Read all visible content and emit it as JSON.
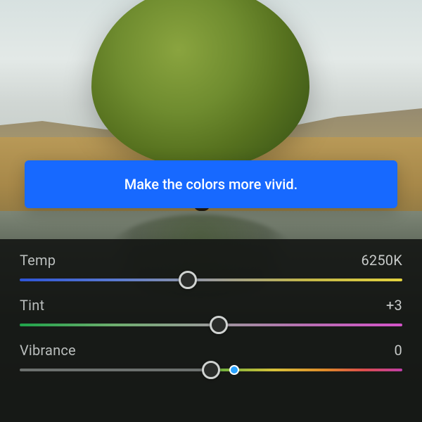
{
  "banner": {
    "message": "Make the colors more vivid."
  },
  "panel": {
    "sliders": {
      "temp": {
        "label": "Temp",
        "value_display": "6250K",
        "position_pct": 44
      },
      "tint": {
        "label": "Tint",
        "value_display": "+3",
        "position_pct": 52
      },
      "vibrance": {
        "label": "Vibrance",
        "value_display": "0",
        "position_pct": 50,
        "hint_dot_pct": 56
      }
    }
  },
  "colors": {
    "accent_banner": "#1769ff",
    "panel_bg": "rgba(20,22,20,0.9)",
    "hint_blue": "#2aa3ff"
  }
}
